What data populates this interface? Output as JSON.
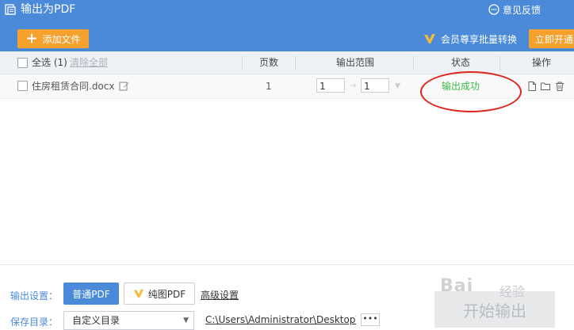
{
  "window": {
    "title": "输出为PDF",
    "feedback_label": "意见反馈"
  },
  "toolbar": {
    "add_file_label": "添加文件",
    "vip_promo_label": "会员尊享批量转换",
    "open_vip_label": "立即开通"
  },
  "table": {
    "select_all_label": "全选 (1)",
    "clear_all_label": "清除全部",
    "columns": {
      "pages": "页数",
      "range": "输出范围",
      "status": "状态",
      "actions": "操作"
    },
    "rows": [
      {
        "filename": "住房租赁合同.docx",
        "pages": "1",
        "range_from": "1",
        "range_to": "1",
        "status": "输出成功"
      }
    ]
  },
  "settings": {
    "output_label": "输出设置：",
    "normal_pdf_label": "普通PDF",
    "pure_pdf_label": "纯图PDF",
    "advanced_label": "高级设置",
    "save_dir_label": "保存目录：",
    "dir_select_value": "自定义目录",
    "path_value": "C:\\Users\\Administrator\\Desktop\\",
    "more_label": "•••",
    "start_label": "开始输出"
  },
  "watermark": {
    "text": "Bai",
    "sub": "经验"
  },
  "colors": {
    "brand_blue": "#4a8ad8",
    "accent_orange": "#f5a12e",
    "success_green": "#3cb94a",
    "annotation_red": "#e0251b"
  }
}
